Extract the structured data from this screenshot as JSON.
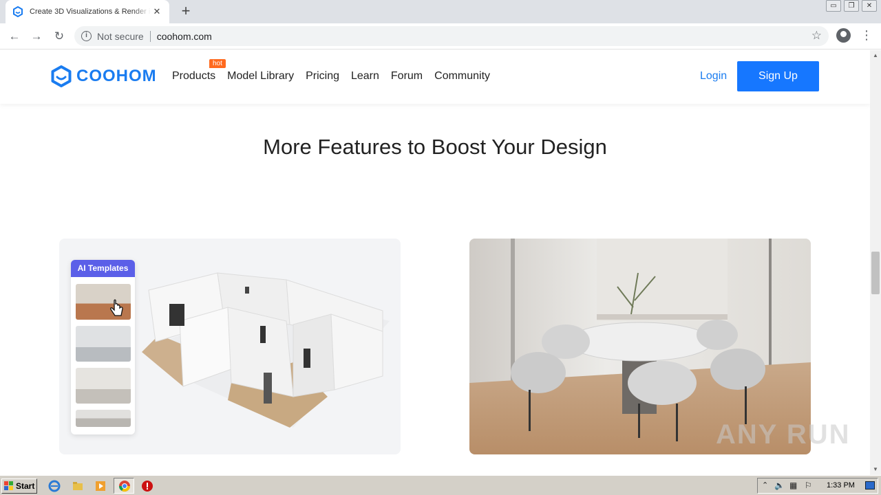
{
  "browser": {
    "tab_title": "Create 3D Visualizations & Render in",
    "tab_close": "✕",
    "new_tab": "+",
    "security_label": "Not secure",
    "url": "coohom.com",
    "window_controls": [
      "▭",
      "❐",
      "✕"
    ]
  },
  "site": {
    "logo_text": "COOHOM",
    "nav": [
      {
        "label": "Products",
        "badge": "hot"
      },
      {
        "label": "Model Library"
      },
      {
        "label": "Pricing"
      },
      {
        "label": "Learn"
      },
      {
        "label": "Forum"
      },
      {
        "label": "Community"
      }
    ],
    "login": "Login",
    "signup": "Sign Up",
    "section_heading": "More Features to Boost Your Design",
    "ai_panel_title": "AI Templates"
  },
  "overlay": {
    "watermark": "ANY RUN"
  },
  "taskbar": {
    "start_label": "Start",
    "clock": "1:33 PM"
  },
  "colors": {
    "brand": "#1a7cf0",
    "signup_bg": "#1677ff",
    "hot_badge": "#ff6a1f",
    "ai_header": "#5b5fe8"
  }
}
